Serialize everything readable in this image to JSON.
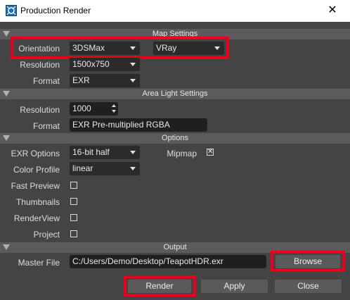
{
  "window": {
    "title": "Production Render",
    "close_glyph": "✕"
  },
  "sections": {
    "map_settings": "Map Settings",
    "area_light_settings": "Area Light Settings",
    "options": "Options",
    "output": "Output"
  },
  "map_settings": {
    "orientation_label": "Orientation",
    "orientation_value": "3DSMax",
    "renderer_value": "VRay",
    "resolution_label": "Resolution",
    "resolution_value": "1500x750",
    "format_label": "Format",
    "format_value": "EXR"
  },
  "area_light_settings": {
    "resolution_label": "Resolution",
    "resolution_value": "1000",
    "format_label": "Format",
    "format_value": "EXR Pre-multiplied RGBA"
  },
  "options": {
    "exr_options_label": "EXR Options",
    "exr_options_value": "16-bit half",
    "mipmap_label": "Mipmap",
    "mipmap_checked": true,
    "color_profile_label": "Color Profile",
    "color_profile_value": "linear",
    "fast_preview_label": "Fast Preview",
    "fast_preview_checked": false,
    "thumbnails_label": "Thumbnails",
    "thumbnails_checked": false,
    "renderview_label": "RenderView",
    "renderview_checked": false,
    "project_label": "Project",
    "project_checked": false,
    "check_glyph": "✕"
  },
  "output": {
    "master_file_label": "Master File",
    "master_file_value": "C:/Users/Demo/Desktop/TeapotHDR.exr",
    "browse_label": "Browse"
  },
  "footer": {
    "render_label": "Render",
    "apply_label": "Apply",
    "close_label": "Close"
  },
  "colors": {
    "highlight": "#e8001c",
    "panel_bg": "#444444",
    "section_bg": "#5b5b5b"
  }
}
